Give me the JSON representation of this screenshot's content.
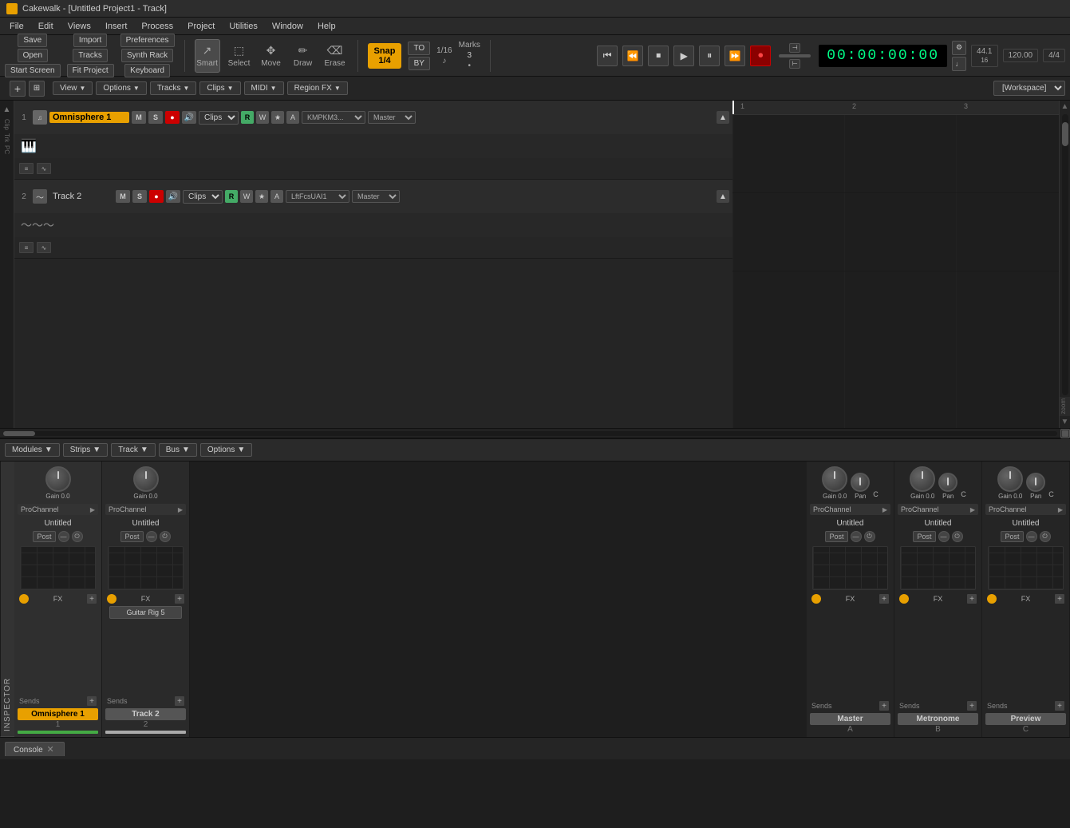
{
  "titlebar": {
    "icon": "cakewalk-icon",
    "title": "Cakewalk - [Untitled Project1 - Track]"
  },
  "menubar": {
    "items": [
      "File",
      "Edit",
      "Views",
      "Insert",
      "Process",
      "Project",
      "Utilities",
      "Window",
      "Help"
    ]
  },
  "toolbar": {
    "file_buttons": {
      "save": "Save",
      "open": "Open",
      "start_screen": "Start Screen"
    },
    "import": "Import",
    "tracks": "Tracks",
    "fit_project": "Fit Project",
    "preferences": "Preferences",
    "synth_rack": "Synth Rack",
    "keyboard": "Keyboard",
    "tools": {
      "smart": "Smart",
      "select": "Select",
      "move": "Move",
      "draw": "Draw",
      "erase": "Erase"
    },
    "snap": {
      "label": "Snap",
      "value": "1/16",
      "by_label": "BY",
      "to_label": "TO"
    },
    "snap_value_display": "1/4",
    "marks": {
      "label": "Marks",
      "value": "3"
    }
  },
  "transport": {
    "time": "00:00:00:00",
    "tempo": "120.00",
    "meter": "4/4",
    "sample_rate": "44.1",
    "bit_depth": "16"
  },
  "tracks_header": {
    "view": "View",
    "options": "Options",
    "tracks": "Tracks",
    "clips": "Clips",
    "midi": "MIDI",
    "region_fx": "Region FX",
    "workspace": "[Workspace]"
  },
  "tracks": [
    {
      "num": 1,
      "name": "Omnisphere 1",
      "type": "instrument",
      "controls": {
        "m": "M",
        "s": "S",
        "r": "R",
        "speaker": "🔊",
        "clip_type": "Clips",
        "r_btn": "R",
        "w_btn": "W",
        "star_btn": "★",
        "a_btn": "A",
        "input": "KMPKM3...",
        "output": "Master"
      }
    },
    {
      "num": 2,
      "name": "Track 2",
      "type": "audio",
      "controls": {
        "m": "M",
        "s": "S",
        "r": "R",
        "speaker": "🔊",
        "clip_type": "Clips",
        "r_btn": "R",
        "w_btn": "W",
        "star_btn": "★",
        "a_btn": "A",
        "input": "LftFcsUAI1",
        "output": "Master"
      }
    }
  ],
  "console": {
    "toolbar": {
      "modules": "Modules",
      "strips": "Strips",
      "track": "Track",
      "bus": "Bus",
      "options": "Options"
    },
    "left_strips": [
      {
        "name": "Omnisphere 1",
        "num": "1",
        "gain": "0.0",
        "pan": "",
        "prochannel": "ProChannel",
        "strip_name_label": "Untitled",
        "post": "Post",
        "fx_label": "FX",
        "sends": "Sends",
        "type": "instrument",
        "has_plugin": false
      },
      {
        "name": "Track 2",
        "num": "2",
        "gain": "0.0",
        "pan": "",
        "prochannel": "ProChannel",
        "strip_name_label": "Untitled",
        "post": "Post",
        "fx_label": "FX",
        "sends": "Sends",
        "type": "audio",
        "has_plugin": true,
        "plugin": "Guitar Rig 5"
      }
    ],
    "right_strips": [
      {
        "name": "Master",
        "letter": "A",
        "gain": "0.0",
        "pan": "Pan",
        "c_label": "C",
        "prochannel": "ProChannel",
        "strip_name_label": "Untitled",
        "post": "Post",
        "fx_label": "FX",
        "sends": "Sends"
      },
      {
        "name": "Metronome",
        "letter": "B",
        "gain": "0.0",
        "pan": "Pan",
        "c_label": "C",
        "prochannel": "ProChannel",
        "strip_name_label": "Untitled",
        "post": "Post",
        "fx_label": "FX",
        "sends": "Sends"
      },
      {
        "name": "Preview",
        "letter": "C",
        "gain": "0.0",
        "pan": "Pan",
        "c_label": "C",
        "prochannel": "ProChannel",
        "strip_name_label": "Untitled",
        "post": "Post",
        "fx_label": "FX",
        "sends": "Sends"
      }
    ]
  },
  "inspector": {
    "label": "INSPECTOR"
  },
  "console_footer": {
    "tab": "Console",
    "close": "✕"
  },
  "ruler": {
    "marks": [
      "1",
      "2",
      "3"
    ]
  }
}
